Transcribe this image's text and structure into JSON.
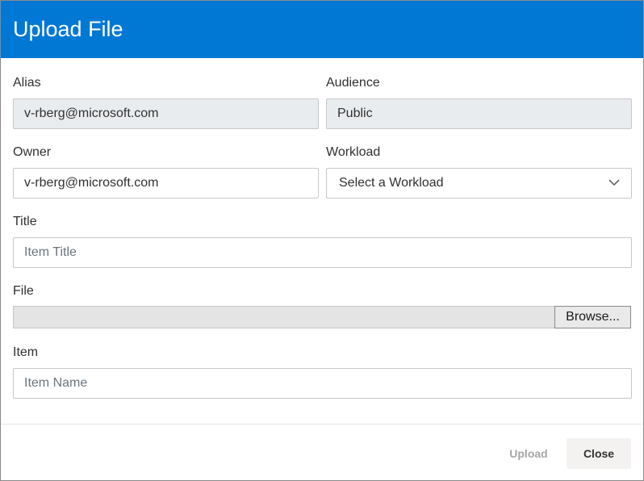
{
  "dialog": {
    "title": "Upload File",
    "accent_color": "#0078d4"
  },
  "form": {
    "alias": {
      "label": "Alias",
      "value": "v-rberg@microsoft.com"
    },
    "audience": {
      "label": "Audience",
      "value": "Public"
    },
    "owner": {
      "label": "Owner",
      "value": "v-rberg@microsoft.com"
    },
    "workload": {
      "label": "Workload",
      "selected": "Select a Workload",
      "icon": "chevron-down-icon"
    },
    "title": {
      "label": "Title",
      "placeholder": "Item Title"
    },
    "file": {
      "label": "File",
      "browse_label": "Browse..."
    },
    "item": {
      "label": "Item",
      "placeholder": "Item Name"
    }
  },
  "footer": {
    "upload_label": "Upload",
    "close_label": "Close"
  }
}
